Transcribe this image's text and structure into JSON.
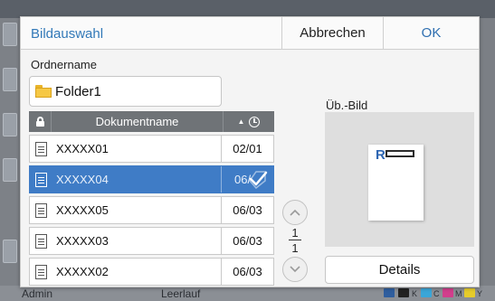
{
  "dialog": {
    "title": "Bildauswahl",
    "cancel_label": "Abbrechen",
    "ok_label": "OK"
  },
  "folder": {
    "label": "Ordnername",
    "name": "Folder1",
    "icon": "folder-icon"
  },
  "table": {
    "header_name": "Dokumentname",
    "sort_indicator": "▲",
    "rows": [
      {
        "name": "XXXXX01",
        "date": "02/01",
        "selected": false
      },
      {
        "name": "XXXXX04",
        "date": "06/",
        "selected": true
      },
      {
        "name": "XXXXX05",
        "date": "06/03",
        "selected": false
      },
      {
        "name": "XXXXX03",
        "date": "06/03",
        "selected": false
      },
      {
        "name": "XXXXX02",
        "date": "06/03",
        "selected": false
      }
    ]
  },
  "pager": {
    "current": "1",
    "total": "1"
  },
  "preview": {
    "label": "Üb.-Bild",
    "logo": "R"
  },
  "details_label": "Details",
  "background": {
    "user": "Admin",
    "status": "Leerlauf",
    "toner": [
      "K",
      "C",
      "M",
      "Y"
    ]
  },
  "colors": {
    "accent": "#3279b8",
    "selection": "#3f7cc6",
    "header": "#6f7377"
  }
}
